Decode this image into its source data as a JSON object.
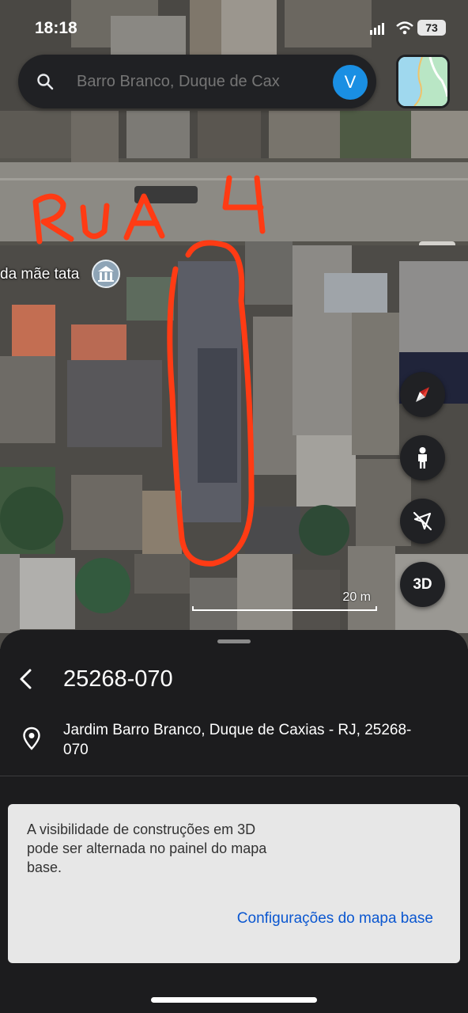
{
  "status_bar": {
    "time": "18:18",
    "battery": "73"
  },
  "search": {
    "placeholder": "Barro Branco, Duque de Cax",
    "avatar_letter": "V",
    "icon": "search-icon"
  },
  "map": {
    "handwritten_annotation": "RUA 4",
    "place_label": "da mãe tata",
    "scale_label": "20 m",
    "three_d_label": "3D",
    "controls": [
      "compass-icon",
      "street-view-icon",
      "location-off-icon",
      "3d-button"
    ]
  },
  "sheet": {
    "title": "25268-070",
    "address": "Jardim Barro Branco, Duque de Caxias - RJ, 25268-070"
  },
  "toast": {
    "message": "A visibilidade de construções em 3D pode ser alternada no painel do mapa base.",
    "action": "Configurações do mapa base"
  },
  "colors": {
    "accent": "#0b57d0",
    "avatar": "#1a8fe3",
    "annotation": "#ff3b14",
    "sheet_bg": "#1c1c1e"
  }
}
